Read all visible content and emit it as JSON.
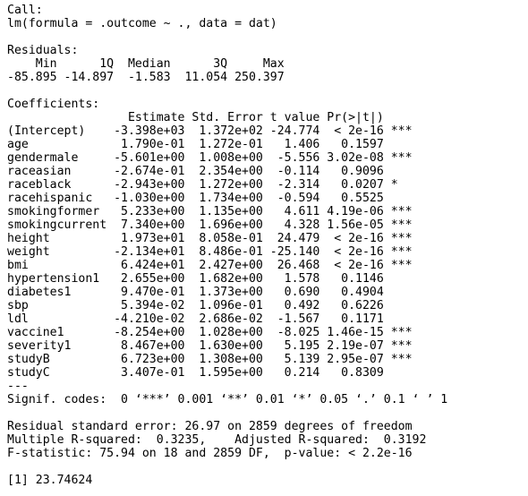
{
  "call": {
    "header": "Call:",
    "formula": "lm(formula = .outcome ~ ., data = dat)"
  },
  "residuals": {
    "header": "Residuals:",
    "labels_line": "    Min      1Q  Median      3Q     Max ",
    "values_line": "-85.895 -14.897  -1.583  11.054 250.397 "
  },
  "coefficients": {
    "header": "Coefficients:",
    "column_header": "                 Estimate Std. Error t value Pr(>|t|)    ",
    "rows": [
      "(Intercept)    -3.398e+03  1.372e+02 -24.774  < 2e-16 ***",
      "age             1.790e-01  1.272e-01   1.406   0.1597    ",
      "gendermale     -5.601e+00  1.008e+00  -5.556 3.02e-08 ***",
      "raceasian      -2.674e-01  2.354e+00  -0.114   0.9096    ",
      "raceblack      -2.943e+00  1.272e+00  -2.314   0.0207 *  ",
      "racehispanic   -1.030e+00  1.734e+00  -0.594   0.5525    ",
      "smokingformer   5.233e+00  1.135e+00   4.611 4.19e-06 ***",
      "smokingcurrent  7.340e+00  1.696e+00   4.328 1.56e-05 ***",
      "height          1.973e+01  8.058e-01  24.479  < 2e-16 ***",
      "weight         -2.134e+01  8.486e-01 -25.140  < 2e-16 ***",
      "bmi             6.424e+01  2.427e+00  26.468  < 2e-16 ***",
      "hypertension1   2.655e+00  1.682e+00   1.578   0.1146    ",
      "diabetes1       9.470e-01  1.373e+00   0.690   0.4904    ",
      "sbp             5.394e-02  1.096e-01   0.492   0.6226    ",
      "ldl            -4.210e-02  2.686e-02  -1.567   0.1171    ",
      "vaccine1       -8.254e+00  1.028e+00  -8.025 1.46e-15 ***",
      "severity1       8.467e+00  1.630e+00   5.195 2.19e-07 ***",
      "studyB          6.723e+00  1.308e+00   5.139 2.95e-07 ***",
      "studyC          3.407e-01  1.595e+00   0.214   0.8309    "
    ],
    "separator": "---",
    "signif_codes": "Signif. codes:  0 ‘***’ 0.001 ‘**’ 0.01 ‘*’ 0.05 ‘.’ 0.1 ‘ ’ 1"
  },
  "summary_stats": {
    "residual_se": "Residual standard error: 26.97 on 2859 degrees of freedom",
    "r_squared": "Multiple R-squared:  0.3235,    Adjusted R-squared:  0.3192 ",
    "f_statistic": "F-statistic: 75.94 on 18 and 2859 DF,  p-value: < 2.2e-16"
  },
  "result_line": "[1] 23.74624"
}
